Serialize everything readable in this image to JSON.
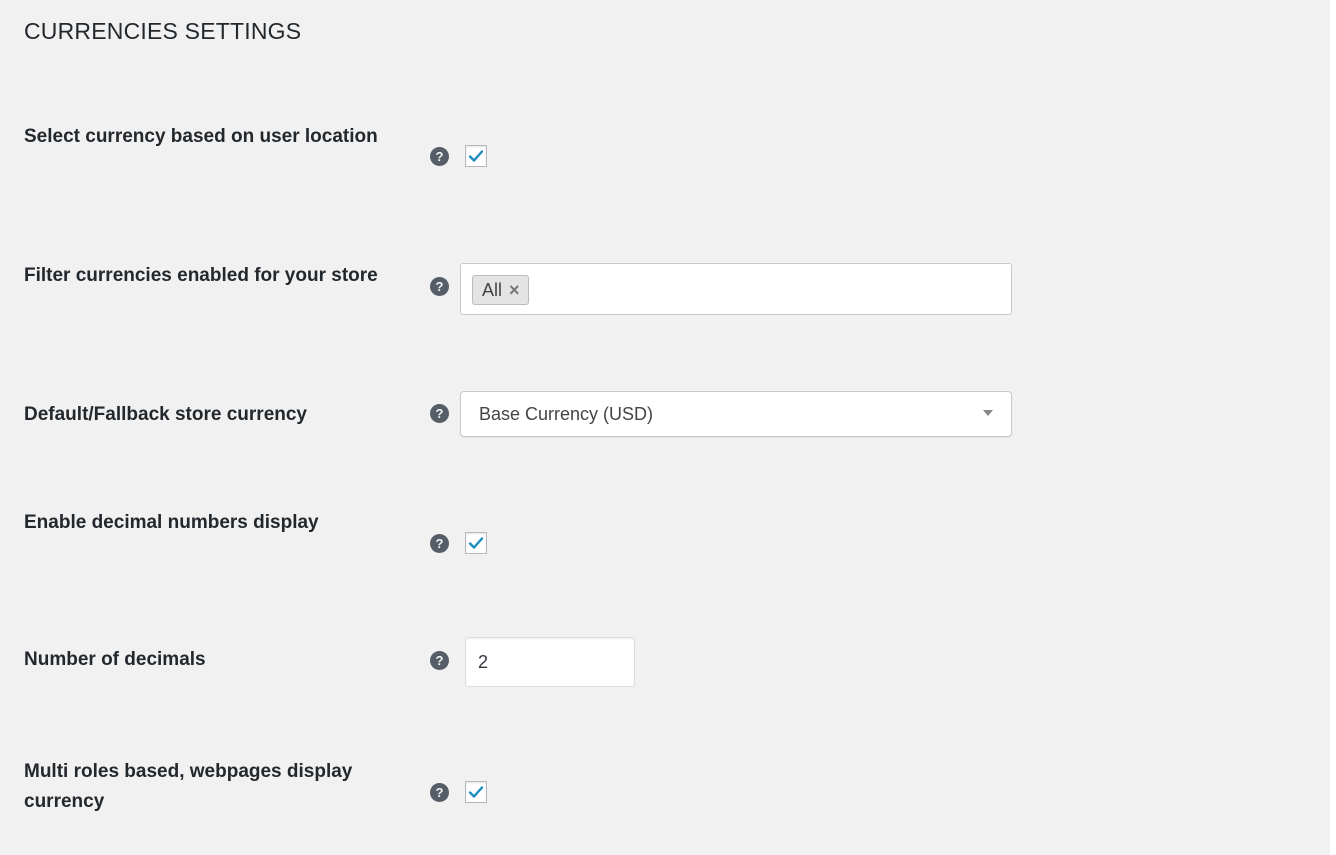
{
  "page": {
    "title": "CURRENCIES SETTINGS"
  },
  "settings": {
    "location": {
      "label": "Select currency based on user location",
      "help_icon": "question-circle-icon",
      "checked": true
    },
    "filter": {
      "label": "Filter currencies enabled for your store",
      "help_icon": "question-circle-icon",
      "tags": [
        {
          "label": "All",
          "remove_symbol": "×"
        }
      ]
    },
    "default_currency": {
      "label": "Default/Fallback store currency",
      "help_icon": "question-circle-icon",
      "selected": "Base Currency (USD)"
    },
    "decimals_display": {
      "label": "Enable decimal numbers display",
      "help_icon": "question-circle-icon",
      "checked": true
    },
    "num_decimals": {
      "label": "Number of decimals",
      "help_icon": "question-circle-icon",
      "value": "2"
    },
    "multi_roles": {
      "label": "Multi roles based, webpages display currency",
      "help_icon": "question-circle-icon",
      "checked": true
    }
  },
  "colors": {
    "background": "#f1f1f1",
    "checkmark": "#1e8cbe",
    "help_icon": "#555d66",
    "label_text": "#23282d"
  }
}
